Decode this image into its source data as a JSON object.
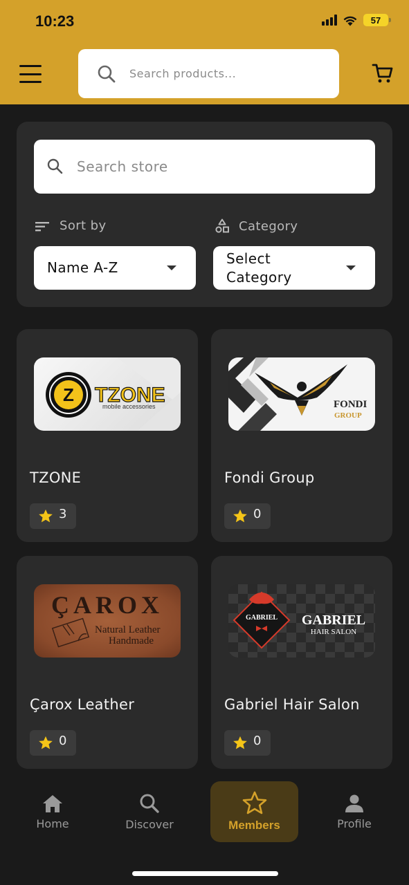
{
  "status_bar": {
    "time": "10:23",
    "battery": "57"
  },
  "header": {
    "search_placeholder": "Search products..."
  },
  "filters": {
    "store_search_placeholder": "Search store",
    "sort_label": "Sort by",
    "sort_value": "Name A-Z",
    "category_label": "Category",
    "category_value": "Select Category"
  },
  "stores": [
    {
      "name": "TZONE",
      "rating": "3",
      "logo": {
        "brand": "TZONE",
        "sub": "mobile accessories",
        "badge": "Z"
      }
    },
    {
      "name": "Fondi Group",
      "rating": "0",
      "logo": {
        "line1": "FONDI",
        "line2": "GROUP"
      }
    },
    {
      "name": "Çarox Leather",
      "rating": "0",
      "logo": {
        "brand": "ÇAROX",
        "line1": "Natural Leather",
        "line2": "Handmade"
      }
    },
    {
      "name": "Gabriel Hair Salon",
      "rating": "0",
      "logo": {
        "badge": "GABRIEL",
        "brand": "GABRIEL",
        "sub": "HAIR SALON"
      }
    }
  ],
  "bottom_nav": [
    {
      "label": "Home",
      "icon": "home-icon"
    },
    {
      "label": "Discover",
      "icon": "search-icon"
    },
    {
      "label": "Members",
      "icon": "star-icon",
      "active": true
    },
    {
      "label": "Profile",
      "icon": "person-icon"
    }
  ],
  "colors": {
    "accent": "#d4a12a",
    "background": "#1a1a1a",
    "card": "#2b2b2b",
    "star": "#f5c518"
  }
}
